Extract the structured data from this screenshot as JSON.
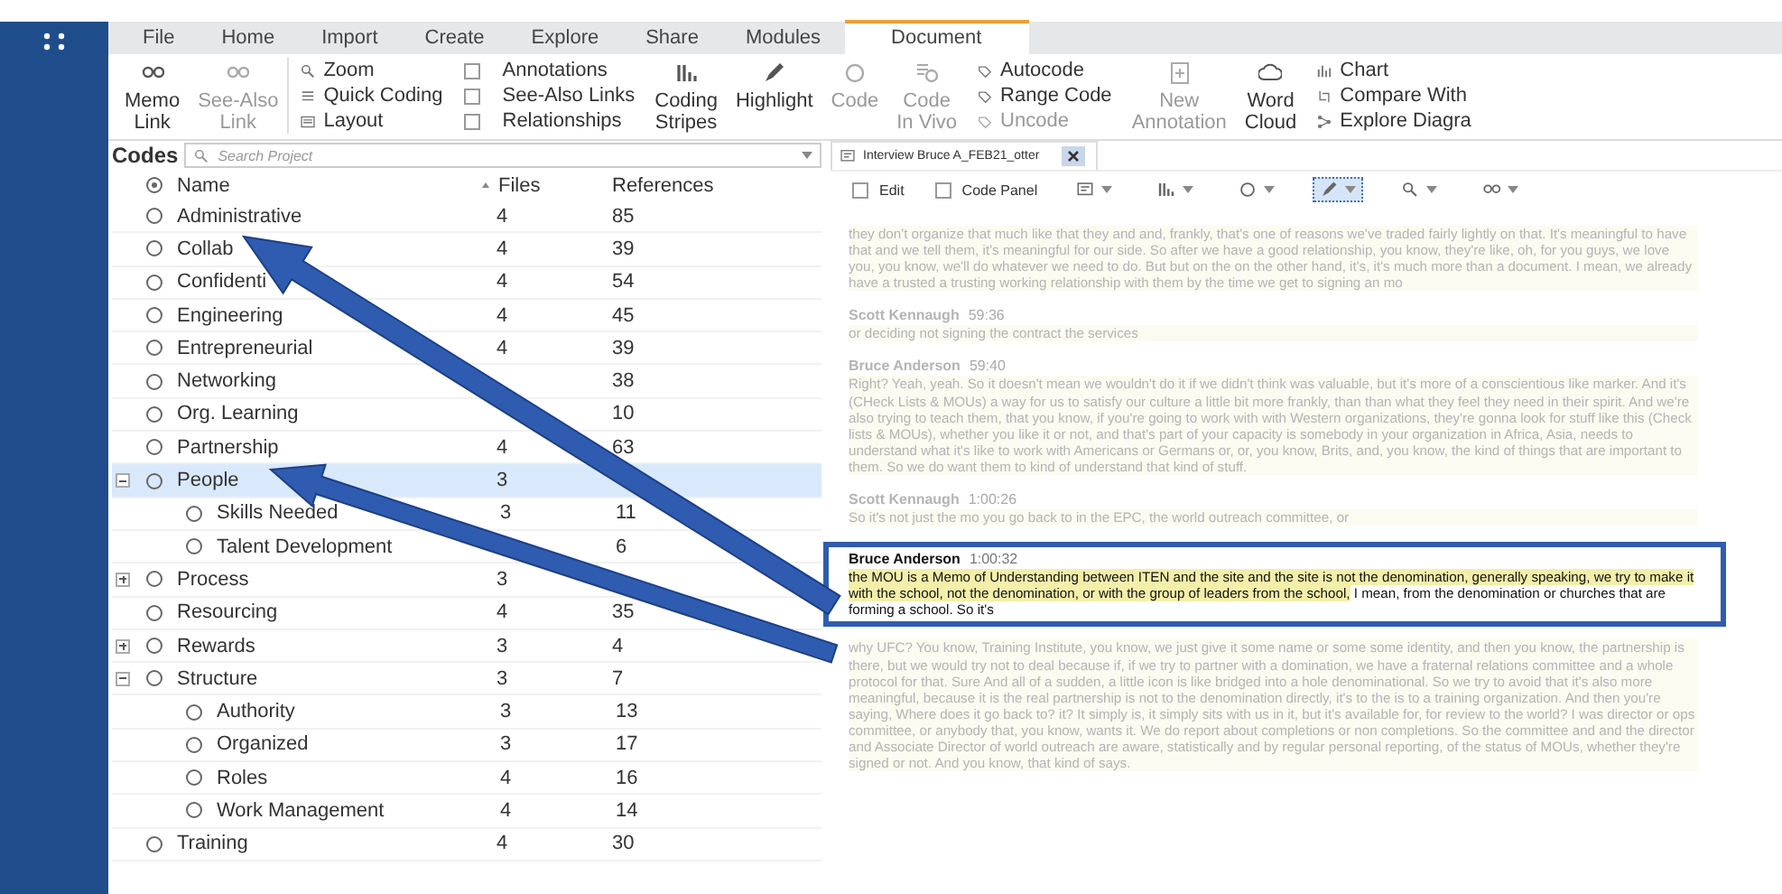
{
  "menu_tabs": [
    {
      "label": "File",
      "selected": false
    },
    {
      "label": "Home",
      "selected": false
    },
    {
      "label": "Import",
      "selected": false
    },
    {
      "label": "Create",
      "selected": false
    },
    {
      "label": "Explore",
      "selected": false
    },
    {
      "label": "Share",
      "selected": false
    },
    {
      "label": "Modules",
      "selected": false
    },
    {
      "label": "Document",
      "selected": true
    }
  ],
  "ribbon": [
    {
      "kind": "big",
      "lines": [
        "Memo",
        "Link"
      ],
      "disabled": false
    },
    {
      "kind": "big",
      "lines": [
        "See-Also",
        "Link"
      ],
      "disabled": true
    },
    {
      "kind": "stack",
      "items": [
        {
          "kind": "icon",
          "label": "Zoom",
          "disabled": false
        },
        {
          "kind": "icon",
          "label": "Quick Coding",
          "disabled": false
        },
        {
          "kind": "icon",
          "label": "Layout",
          "disabled": false
        }
      ]
    },
    {
      "kind": "stack",
      "items": [
        {
          "kind": "check",
          "label": "Annotations",
          "checked": false
        },
        {
          "kind": "check",
          "label": "See-Also Links",
          "checked": false
        },
        {
          "kind": "check",
          "label": "Relationships",
          "checked": false
        }
      ]
    },
    {
      "kind": "big",
      "lines": [
        "Coding",
        "Stripes"
      ],
      "disabled": false
    },
    {
      "kind": "big",
      "lines": [
        "Highlight"
      ],
      "disabled": false
    },
    {
      "kind": "big",
      "lines": [
        "Code"
      ],
      "disabled": true
    },
    {
      "kind": "big",
      "lines": [
        "Code",
        "In Vivo"
      ],
      "disabled": true
    },
    {
      "kind": "stack",
      "items": [
        {
          "kind": "icon",
          "label": "Autocode",
          "disabled": false
        },
        {
          "kind": "icon",
          "label": "Range Code",
          "disabled": false
        },
        {
          "kind": "icon",
          "label": "Uncode",
          "disabled": true
        }
      ]
    },
    {
      "kind": "big",
      "lines": [
        "New",
        "Annotation"
      ],
      "disabled": true
    },
    {
      "kind": "big",
      "lines": [
        "Word",
        "Cloud"
      ],
      "disabled": false
    },
    {
      "kind": "stack",
      "items": [
        {
          "kind": "icon",
          "label": "Chart",
          "disabled": false
        },
        {
          "kind": "icon",
          "label": "Compare With",
          "disabled": false
        },
        {
          "kind": "icon",
          "label": "Explore Diagra",
          "disabled": false
        }
      ]
    }
  ],
  "codes": {
    "title": "Codes",
    "search": {
      "placeholder": "Search Project"
    },
    "columns": [
      "Name",
      "Files",
      "References"
    ],
    "rows": [
      {
        "kind": "leaf",
        "name": "Administrative",
        "files": "4",
        "references": "85",
        "selected": false
      },
      {
        "kind": "leaf",
        "name": "Collab",
        "files": "4",
        "references": "39",
        "selected": false
      },
      {
        "kind": "leaf",
        "name": "Confidenti",
        "files": "4",
        "references": "54",
        "selected": false
      },
      {
        "kind": "leaf",
        "name": "Engineering",
        "files": "4",
        "references": "45",
        "selected": false
      },
      {
        "kind": "leaf",
        "name": "Entrepreneurial",
        "files": "4",
        "references": "39",
        "selected": false
      },
      {
        "kind": "leaf",
        "name": "Networking",
        "references": "38",
        "selected": false
      },
      {
        "kind": "leaf",
        "name": "Org. Learning",
        "references": "10",
        "selected": false
      },
      {
        "kind": "leaf",
        "name": "Partnership",
        "files": "4",
        "references": "63",
        "selected": false
      },
      {
        "kind": "group",
        "name": "People",
        "files": "3",
        "expanded": true,
        "selected": true,
        "children": [
          {
            "name": "Skills Needed",
            "files": "3",
            "references": "11",
            "selected": false
          },
          {
            "name": "Talent Development",
            "references": "6",
            "selected": false
          }
        ]
      },
      {
        "kind": "group",
        "name": "Process",
        "files": "3",
        "expanded": false,
        "selected": false
      },
      {
        "kind": "leaf",
        "name": "Resourcing",
        "files": "4",
        "references": "35",
        "selected": false
      },
      {
        "kind": "group",
        "name": "Rewards",
        "files": "3",
        "references": "4",
        "expanded": false,
        "selected": false
      },
      {
        "kind": "group",
        "name": "Structure",
        "files": "3",
        "references": "7",
        "expanded": true,
        "selected": false,
        "children": [
          {
            "name": "Authority",
            "files": "3",
            "references": "13",
            "selected": false
          },
          {
            "name": "Organized",
            "files": "3",
            "references": "17",
            "selected": false
          },
          {
            "name": "Roles",
            "files": "4",
            "references": "16",
            "selected": false
          },
          {
            "name": "Work Management",
            "files": "4",
            "references": "14",
            "selected": false
          }
        ]
      },
      {
        "kind": "leaf",
        "name": "Training",
        "files": "4",
        "references": "30",
        "selected": false
      }
    ]
  },
  "document": {
    "tab": "Interview Bruce A_FEB21_otter",
    "toolbar": [
      {
        "kind": "check",
        "label": "Edit",
        "checked": false
      },
      {
        "kind": "check",
        "label": "Code Panel",
        "checked": false
      },
      {
        "kind": "menu",
        "selected": false
      },
      {
        "kind": "menu",
        "selected": false
      },
      {
        "kind": "menu",
        "selected": false
      },
      {
        "kind": "menu",
        "selected": true
      },
      {
        "kind": "menu",
        "selected": false
      },
      {
        "kind": "menu",
        "selected": false
      }
    ],
    "blocks": [
      {
        "kind": "faded",
        "text": "they don't organize that much like that they and and, frankly, that's one of reasons we've traded fairly lightly on that. It's meaningful to have that and we tell them, it's meaningful for our side. So after we have a good relationship, you know, they're like, oh, for you guys, we love you, you know, we'll do whatever we need to do. But but on the on the other hand, it's, it's much more than a document. I mean, we already have a trusted a trusting working relationship with them by the time we get to signing an mo"
      },
      {
        "kind": "faded",
        "speaker": "Scott Kennaugh",
        "time": "59:36",
        "text": "or deciding not signing the contract the services"
      },
      {
        "kind": "faded",
        "speaker": "Bruce Anderson",
        "time": "59:40",
        "text": "Right? Yeah, yeah. So it doesn't mean we wouldn't do it if we didn't think was valuable, but it's more of a conscientious like marker. And it's (CHeck Lists & MOUs) a way for us to satisfy our culture a little bit more frankly, than than what they feel they need in their spirit. And we're also trying to teach them, that you know, if you're going to work with with Western organizations, they're gonna look for stuff like this (Check lists & MOUs), whether you like it or not, and that's part of your capacity is somebody in your organization in Africa, Asia, needs to understand what it's like to work with Americans or Germans or, or, you know, Brits, and, you know, the kind of things that are important to them. So we do want them to kind of understand that kind of stuff."
      },
      {
        "kind": "faded",
        "speaker": "Scott Kennaugh",
        "time": "1:00:26",
        "text": "So it's not just the mo you go back to in the EPC, the world outreach committee, or"
      },
      {
        "kind": "focus",
        "speaker": "Bruce Anderson",
        "time": "1:00:32",
        "highlighted": "the MOU is a Memo of Understanding between ITEN and the site and the site is not the denomination, generally speaking, we try to make it with the school, not the denomination, or with the group of leaders from the school,",
        "text": " I mean, from the denomination or churches that are forming a school. So it's"
      },
      {
        "kind": "faded",
        "text": "why UFC? You know, Training Institute, you know, we just give it some name or some some identity, and then you know, the partnership is there, but we would try not to deal because if, if we try to partner with a domination, we have a fraternal relations committee and a whole protocol for that. Sure And all of a sudden, a little icon is like bridged into a hole denominational. So we try to avoid that it's also more meaningful, because it is the real partnership is not to the denomination directly, it's to the is to a training organization. And then you're saying, Where does it go back to? it? It simply is, it simply sits with us in it, but it's available for, for review to the world? I was director or ops committee, or anybody that, you know, wants it. We do report about completions or non completions. So the committee and and the director and Associate Director of world outreach are aware, statistically and by regular personal reporting, of the status of MOUs, whether they're signed or not. And you know, that kind of says."
      }
    ]
  }
}
